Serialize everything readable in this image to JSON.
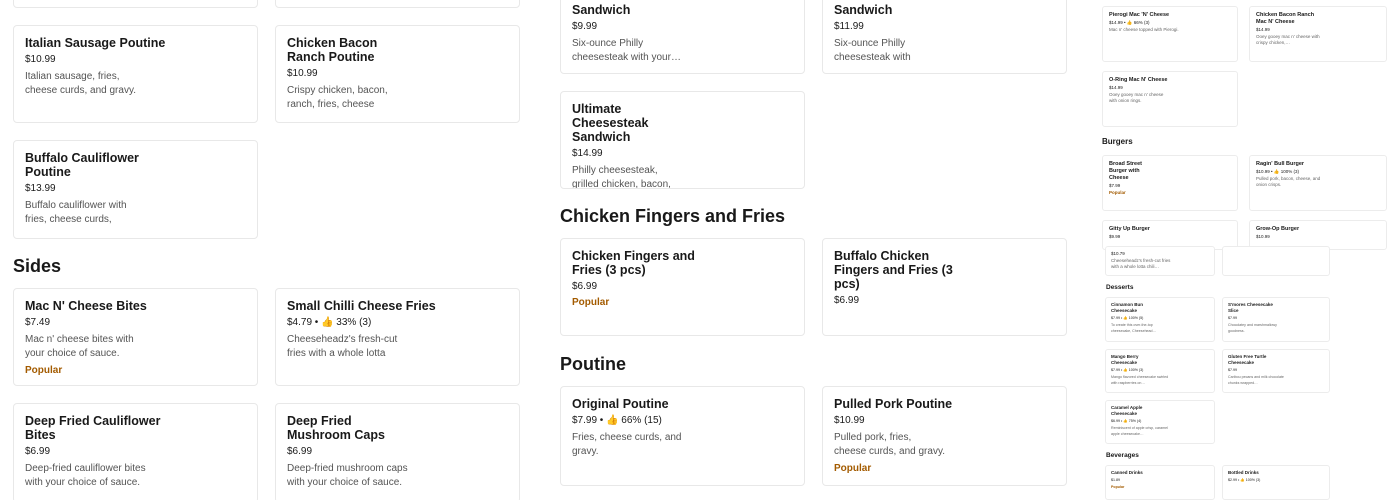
{
  "left_column": {
    "items": [
      {
        "title": "Italian Sausage Poutine",
        "price": "$10.99",
        "desc": "Italian sausage, fries, cheese curds, and gravy.",
        "popular": ""
      },
      {
        "title": "Chicken Bacon Ranch Poutine",
        "price": "$10.99",
        "desc": "Crispy chicken, bacon, ranch, fries, cheese curds,…",
        "popular": ""
      },
      {
        "title": "Buffalo Cauliflower Poutine",
        "price": "$13.99",
        "desc": "Buffalo cauliflower with fries, cheese curds, and…",
        "popular": ""
      }
    ],
    "sides_heading": "Sides",
    "sides": [
      {
        "title": "Mac N' Cheese Bites",
        "price": "$7.49",
        "desc": "Mac n' cheese bites with your choice of sauce.",
        "popular": "Popular"
      },
      {
        "title": "Small Chilli Cheese Fries",
        "price": "$4.79 • 👍 33% (3)",
        "desc": "Cheeseheadz's fresh-cut fries with a whole lotta chili…",
        "popular": ""
      },
      {
        "title": "Deep Fried Cauliflower Bites",
        "price": "$6.99",
        "desc": "Deep-fried cauliflower bites with your choice of sauce.",
        "popular": ""
      },
      {
        "title": "Deep Fried Mushroom Caps",
        "price": "$6.99",
        "desc": "Deep-fried mushroom caps with your choice of sauce.",
        "popular": ""
      }
    ]
  },
  "mid_column": {
    "top": [
      {
        "title": "Sandwich",
        "price": "$9.99",
        "desc": "Six-ounce Philly cheesesteak with your…"
      },
      {
        "title": "Sandwich",
        "price": "$11.99",
        "desc": "Six-ounce Philly cheesesteak with bacon,…"
      }
    ],
    "ultimate": {
      "title": "Ultimate Cheesesteak Sandwich",
      "price": "$14.99",
      "desc": "Philly cheesesteak, grilled chicken, bacon, peameal…"
    },
    "fingers_heading": "Chicken Fingers and Fries",
    "fingers": [
      {
        "title": "Chicken Fingers and Fries (3 pcs)",
        "price": "$6.99",
        "popular": "Popular"
      },
      {
        "title": "Buffalo Chicken Fingers and Fries (3 pcs)",
        "price": "$6.99",
        "popular": ""
      }
    ],
    "poutine_heading": "Poutine",
    "poutine": [
      {
        "title": "Original Poutine",
        "price": "$7.99 • 👍 66% (15)",
        "desc": "Fries, cheese curds, and gravy.",
        "popular": ""
      },
      {
        "title": "Pulled Pork Poutine",
        "price": "$10.99",
        "desc": "Pulled pork, fries, cheese curds, and gravy.",
        "popular": "Popular"
      }
    ]
  },
  "sidebar": {
    "mac": [
      {
        "title": "Pierogi Mac 'N' Cheese",
        "price": "$14.99 • 👍 66% (3)",
        "desc": "Mac n' cheese topped with Pierogi."
      },
      {
        "title": "Chicken Bacon Ranch Mac N' Cheese",
        "price": "$14.99",
        "desc": "Ooey gooey mac n' cheese with crispy chicken,…"
      },
      {
        "title": "O-Ring Mac N' Cheese",
        "price": "$14.99",
        "desc": "Ooey gooey mac n' cheese with onion rings."
      }
    ],
    "burgers_heading": "Burgers",
    "burgers": [
      {
        "title": "Broad Street Burger with Cheese",
        "price": "$7.99",
        "desc": "",
        "popular": "Popular"
      },
      {
        "title": "Ragin' Bull Burger",
        "price": "$10.99 • 👍 100% (3)",
        "desc": "Pulled pork, bacon, cheese, and onion crisps.",
        "popular": ""
      },
      {
        "title": "Gitty Up Burger",
        "price": "$9.99",
        "desc": "",
        "popular": ""
      },
      {
        "title": "Grow-Op Burger",
        "price": "$10.99",
        "desc": "",
        "popular": ""
      }
    ],
    "small_item": {
      "price": "$10.79",
      "desc": "Cheeseheadz's fresh-cut fries with a whole lotta chili…"
    },
    "desserts_heading": "Desserts",
    "desserts": [
      {
        "title": "Cinnamon Bun Cheesecake",
        "price": "$7.99 • 👍 100% (5)",
        "desc": "To create this over-the-top cheesecake, Cheesehead…"
      },
      {
        "title": "S'mores Cheesecake Slice",
        "price": "$7.99",
        "desc": "Chocolatey and marshmallowy goodness."
      },
      {
        "title": "Mango Berry Cheesecake",
        "price": "$7.99 • 👍 100% (3)",
        "desc": "Mango flavored cheesecake swirled with raspberries on…"
      },
      {
        "title": "Gluten Free Turtle Cheesecake",
        "price": "$7.99",
        "desc": "Caribou pecans and milk chocolate chunks wrapped…"
      },
      {
        "title": "Caramel Apple Cheesecake",
        "price": "$6.99 • 👍 75% (4)",
        "desc": "Reminiscent of apple crisp, caramel apple cheesecake…"
      }
    ],
    "beverages_heading": "Beverages",
    "beverages": [
      {
        "title": "Canned Drinks",
        "price": "$1.89",
        "popular": "Popular"
      },
      {
        "title": "Bottled Drinks",
        "price": "$2.99 • 👍 100% (3)",
        "popular": ""
      }
    ]
  },
  "colors": {
    "popular": "#a35b00",
    "border": "#e8e8e8",
    "text": "#191919"
  }
}
